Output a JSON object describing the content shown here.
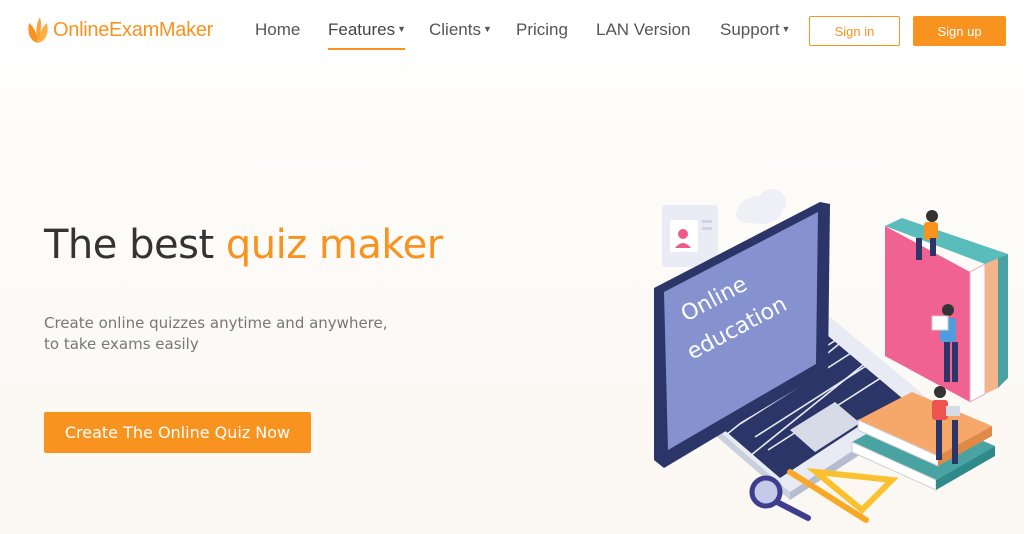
{
  "brand": {
    "name": "OnlineExamMaker",
    "color": "#f7931e"
  },
  "nav": {
    "items": [
      {
        "label": "Home",
        "has_dropdown": false,
        "active": false
      },
      {
        "label": "Features",
        "has_dropdown": true,
        "active": true
      },
      {
        "label": "Clients",
        "has_dropdown": true,
        "active": false
      },
      {
        "label": "Pricing",
        "has_dropdown": false,
        "active": false
      },
      {
        "label": "LAN Version",
        "has_dropdown": false,
        "active": false
      },
      {
        "label": "Support",
        "has_dropdown": true,
        "active": false
      }
    ],
    "sign_in": "Sign in",
    "sign_up": "Sign up"
  },
  "hero": {
    "title_plain": "The best ",
    "title_accent": "quiz maker",
    "subtitle_line1": "Create online quizzes anytime and anywhere,",
    "subtitle_line2": "to take exams easily",
    "cta": "Create The Online Quiz Now"
  },
  "illustration": {
    "screen_text_line1": "Online",
    "screen_text_line2": "education"
  }
}
